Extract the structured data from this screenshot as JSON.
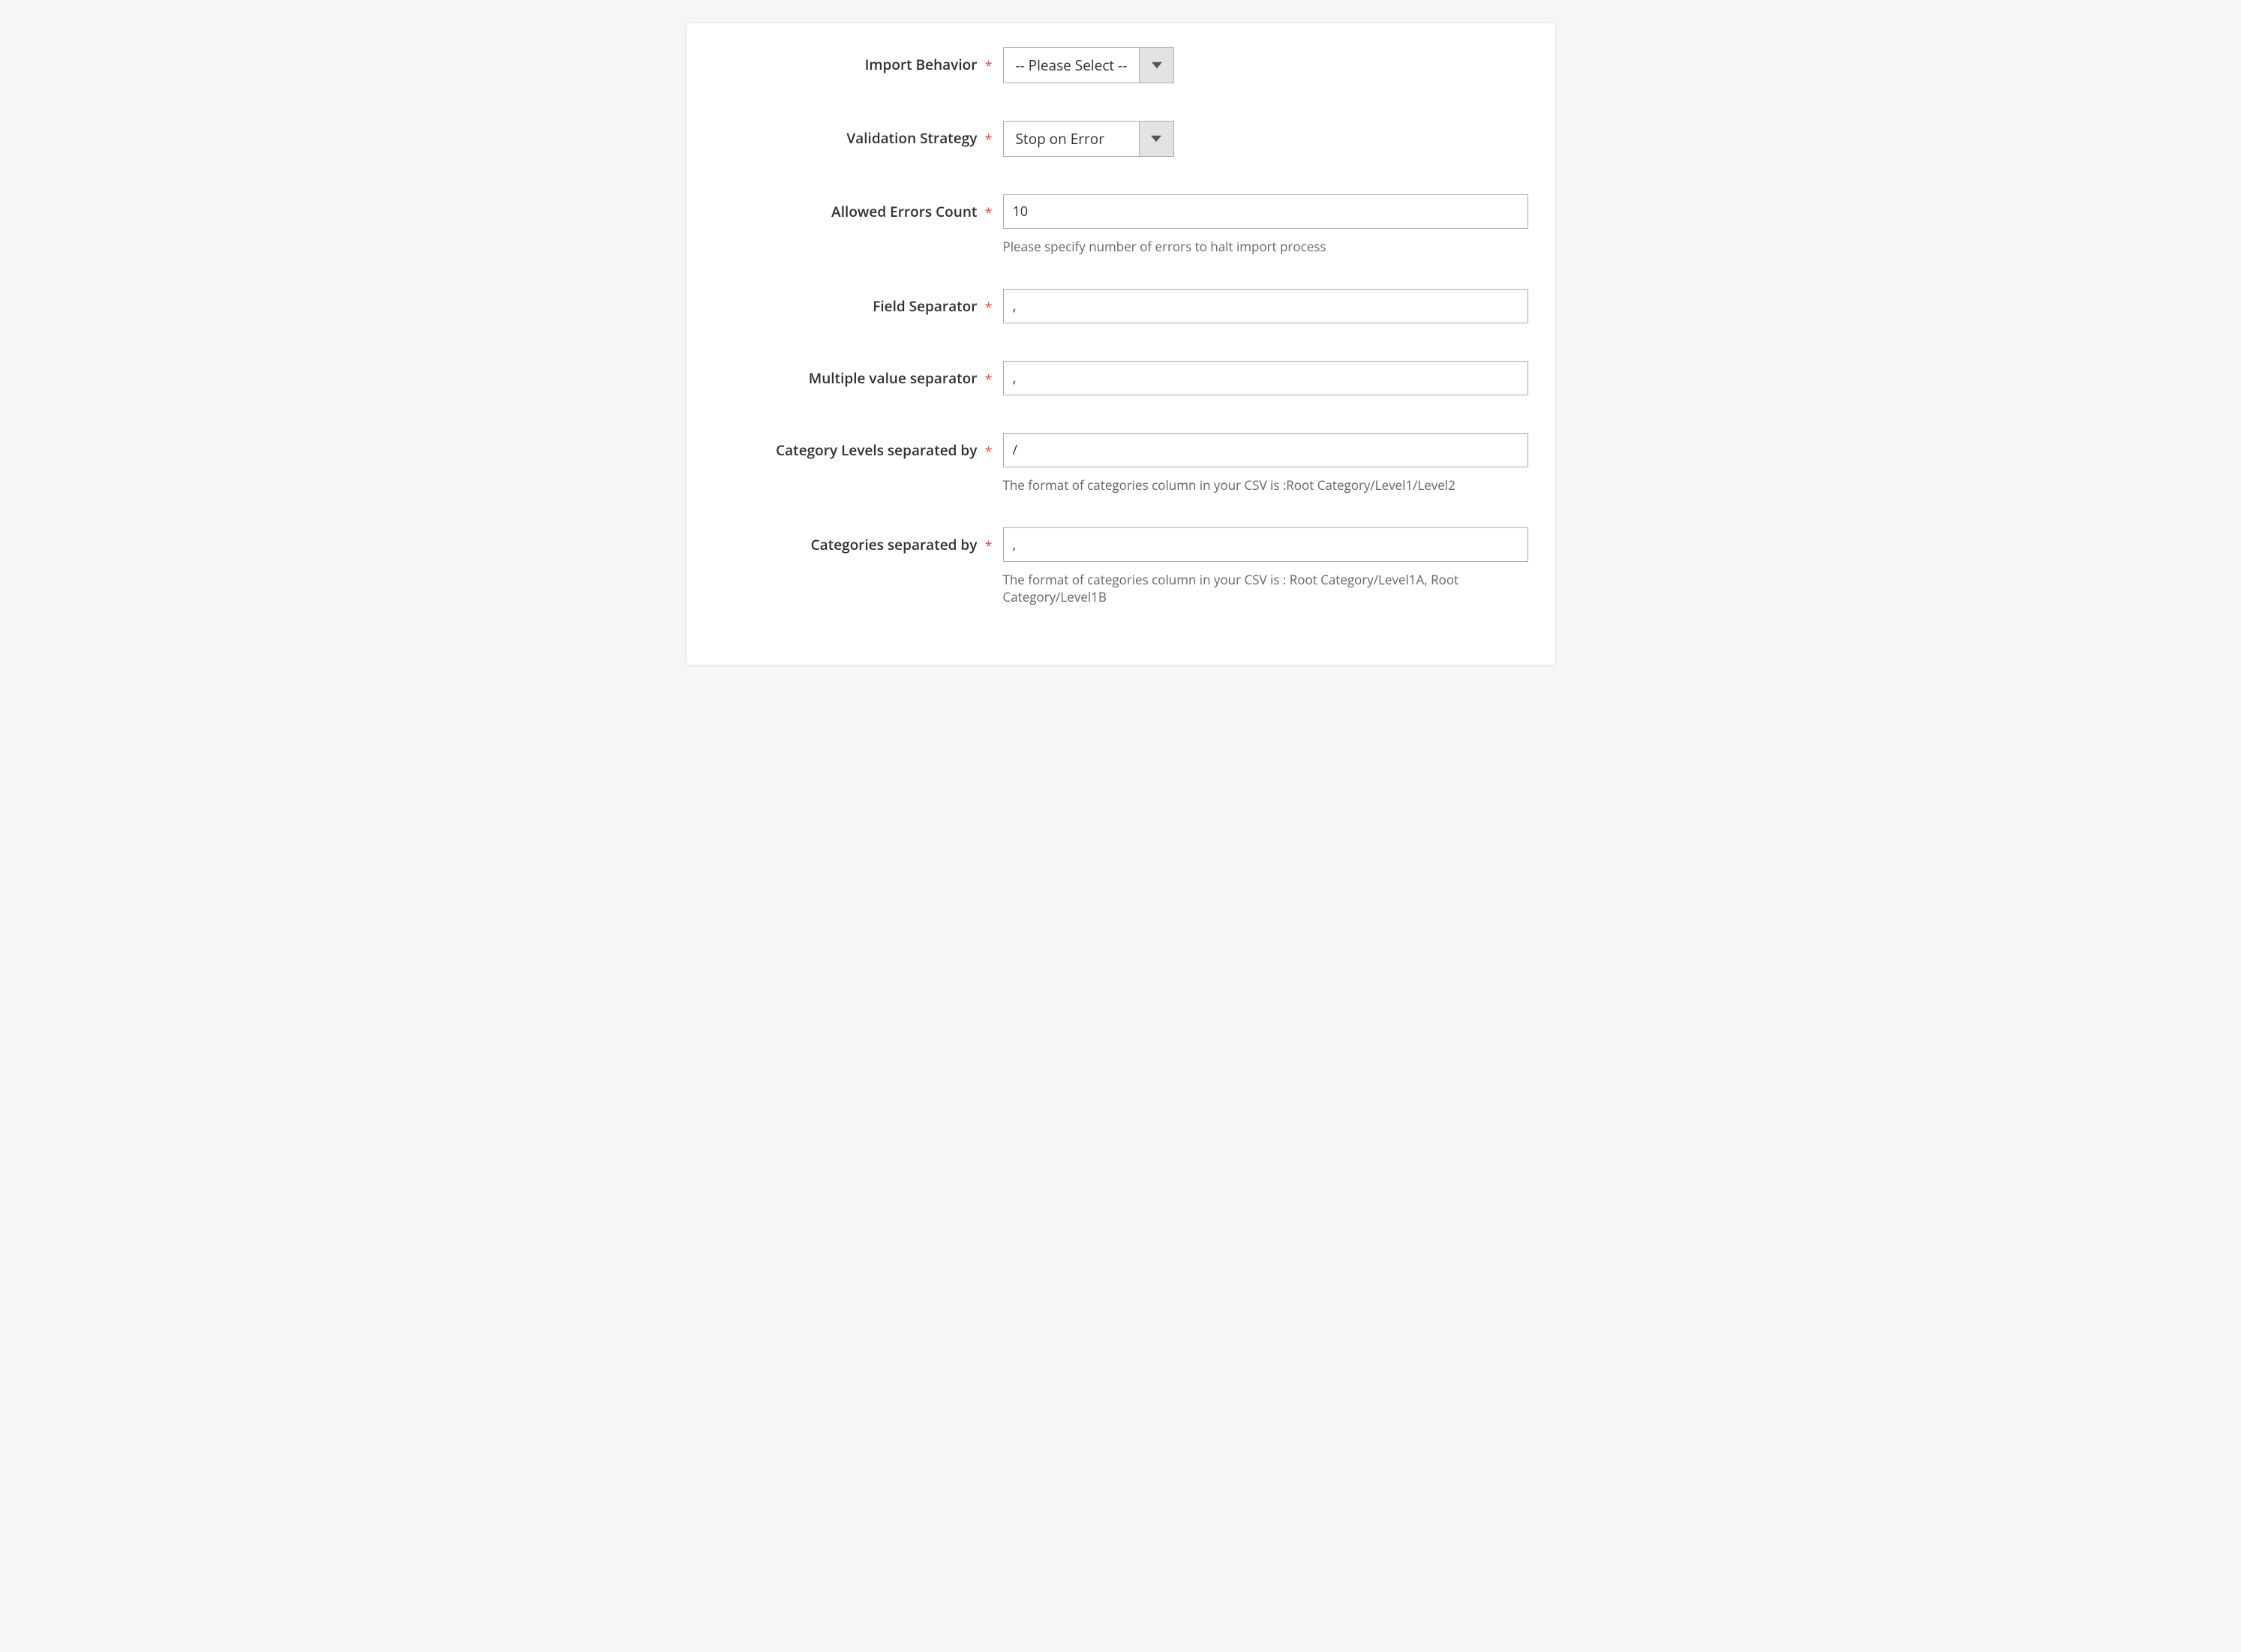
{
  "fields": {
    "import_behavior": {
      "label": "Import Behavior",
      "value": "-- Please Select --"
    },
    "validation_strategy": {
      "label": "Validation Strategy",
      "value": "Stop on Error"
    },
    "allowed_errors": {
      "label": "Allowed Errors Count",
      "value": "10",
      "hint": "Please specify number of errors to halt import process"
    },
    "field_separator": {
      "label": "Field Separator",
      "value": ","
    },
    "multi_value_separator": {
      "label": "Multiple value separator",
      "value": ","
    },
    "category_levels_sep": {
      "label": "Category Levels separated by",
      "value": "/",
      "hint": "The format of categories column in your CSV is :Root Category/Level1/Level2"
    },
    "categories_sep": {
      "label": "Categories separated by",
      "value": ",",
      "hint": "The format of categories column in your CSV is : Root Category/Level1A, Root Category/Level1B"
    }
  },
  "required_mark": "*"
}
